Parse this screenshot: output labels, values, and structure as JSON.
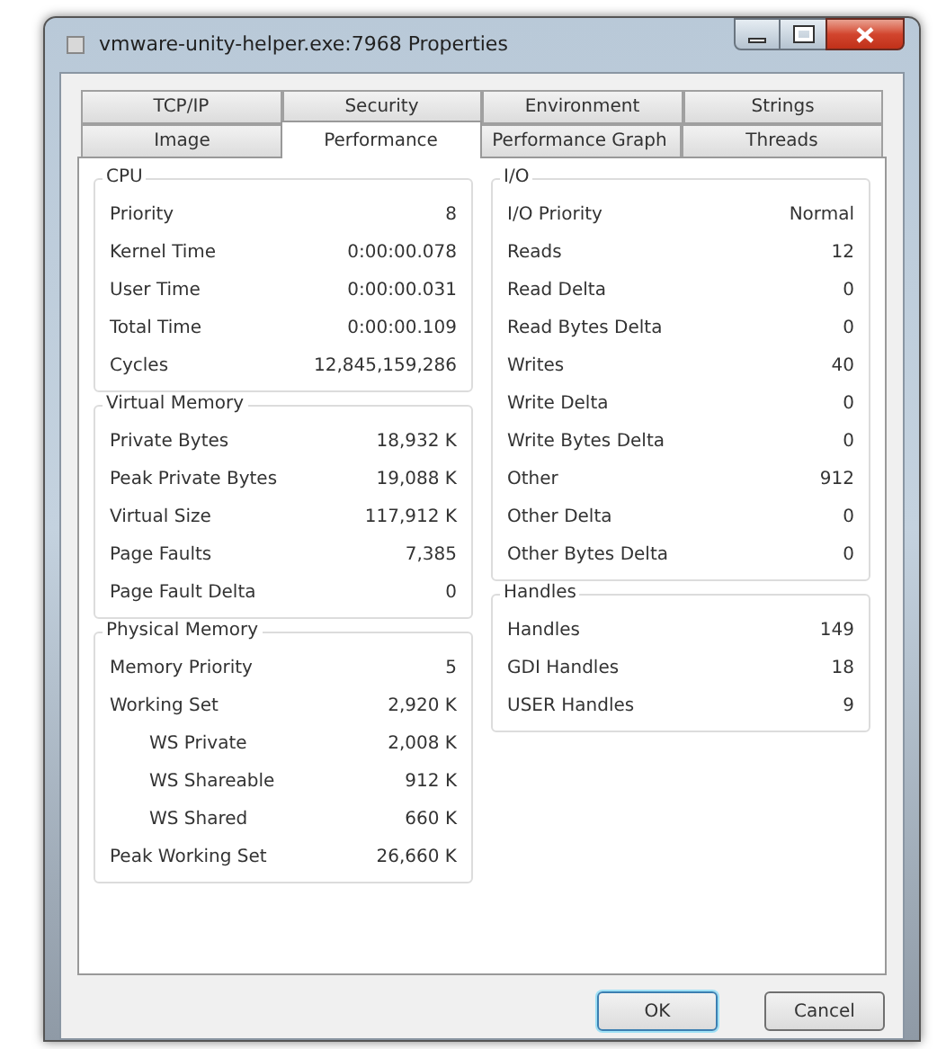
{
  "window": {
    "title": "vmware-unity-helper.exe:7968 Properties"
  },
  "tab_rows": [
    [
      {
        "label": "TCP/IP",
        "selected": false
      },
      {
        "label": "Security",
        "selected": false
      },
      {
        "label": "Environment",
        "selected": false
      },
      {
        "label": "Strings",
        "selected": false
      }
    ],
    [
      {
        "label": "Image",
        "selected": false
      },
      {
        "label": "Performance",
        "selected": true
      },
      {
        "label": "Performance Graph",
        "selected": false
      },
      {
        "label": "Threads",
        "selected": false
      }
    ]
  ],
  "columns": [
    [
      {
        "title": "CPU",
        "rows": [
          {
            "label": "Priority",
            "value": "8"
          },
          {
            "label": "Kernel Time",
            "value": "0:00:00.078"
          },
          {
            "label": "User Time",
            "value": "0:00:00.031"
          },
          {
            "label": "Total Time",
            "value": "0:00:00.109"
          },
          {
            "label": "Cycles",
            "value": "12,845,159,286"
          }
        ]
      },
      {
        "title": "Virtual Memory",
        "rows": [
          {
            "label": "Private Bytes",
            "value": "18,932 K"
          },
          {
            "label": "Peak Private Bytes",
            "value": "19,088 K"
          },
          {
            "label": "Virtual Size",
            "value": "117,912 K"
          },
          {
            "label": "Page Faults",
            "value": "7,385"
          },
          {
            "label": "Page Fault Delta",
            "value": "0"
          }
        ]
      },
      {
        "title": "Physical Memory",
        "rows": [
          {
            "label": "Memory Priority",
            "value": "5"
          },
          {
            "label": "Working Set",
            "value": "2,920 K",
            "children": [
              {
                "label": "WS Private",
                "value": "2,008 K"
              },
              {
                "label": "WS Shareable",
                "value": "912 K"
              },
              {
                "label": "WS Shared",
                "value": "660 K"
              }
            ]
          },
          {
            "label": "Peak Working Set",
            "value": "26,660 K"
          }
        ]
      }
    ],
    [
      {
        "title": "I/O",
        "rows": [
          {
            "label": "I/O Priority",
            "value": "Normal"
          },
          {
            "label": "Reads",
            "value": "12"
          },
          {
            "label": "Read Delta",
            "value": "0"
          },
          {
            "label": "Read Bytes Delta",
            "value": "0"
          },
          {
            "label": "Writes",
            "value": "40"
          },
          {
            "label": "Write Delta",
            "value": "0"
          },
          {
            "label": "Write Bytes Delta",
            "value": "0"
          },
          {
            "label": "Other",
            "value": "912"
          },
          {
            "label": "Other Delta",
            "value": "0"
          },
          {
            "label": "Other Bytes Delta",
            "value": "0"
          }
        ]
      },
      {
        "title": "Handles",
        "rows": [
          {
            "label": "Handles",
            "value": "149"
          },
          {
            "label": "GDI Handles",
            "value": "18"
          },
          {
            "label": "USER Handles",
            "value": "9"
          }
        ]
      }
    ]
  ],
  "buttons": [
    {
      "label": "OK",
      "default": true
    },
    {
      "label": "Cancel",
      "default": false
    }
  ]
}
